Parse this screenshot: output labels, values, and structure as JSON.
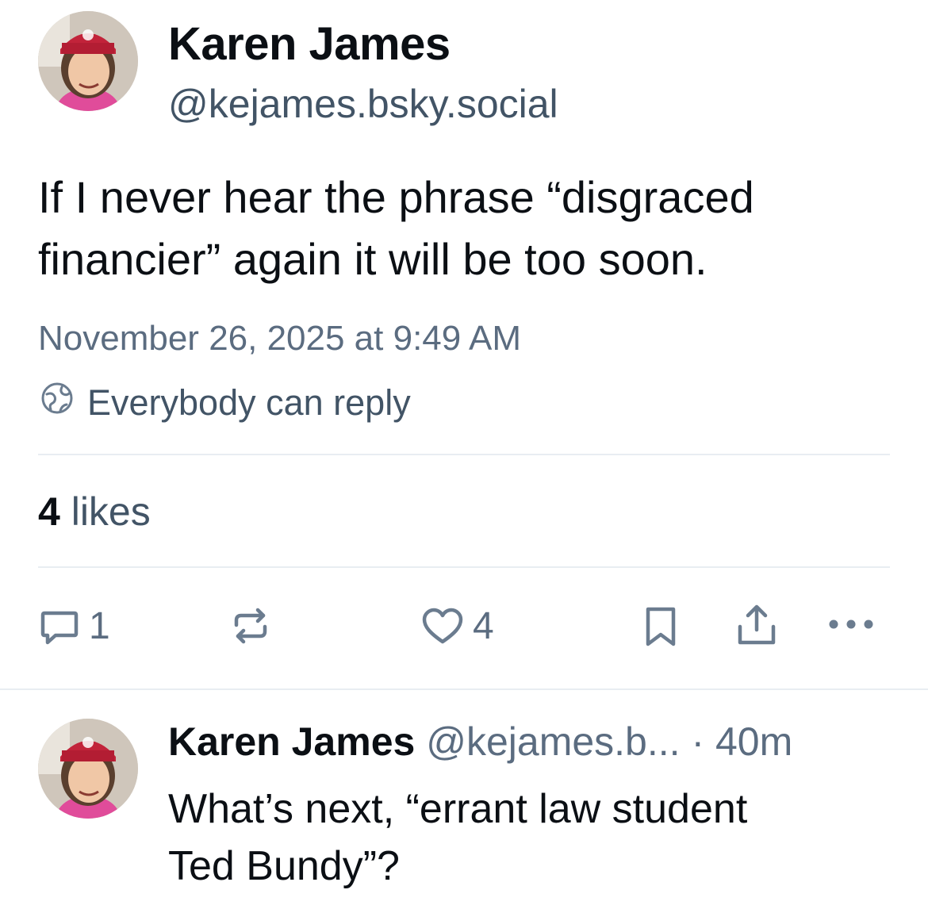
{
  "post": {
    "author_name": "Karen James",
    "author_handle": "@kejames.bsky.social",
    "text_line1": "If I never hear the phrase “disgraced",
    "text_line2": "financier” again it will be too soon.",
    "timestamp": "November 26, 2025 at 9:49 AM",
    "reply_setting": "Everybody can reply",
    "likes_count": "4",
    "likes_label": "likes"
  },
  "actions": {
    "reply_count": "1",
    "like_count": "4",
    "icons": [
      "reply-icon",
      "repost-icon",
      "like-icon",
      "bookmark-icon",
      "share-icon",
      "more-icon"
    ]
  },
  "reply": {
    "author_name": "Karen James",
    "author_handle": "@kejames.b...",
    "separator": "·",
    "age": "40m",
    "text_line1": "What’s next, “errant law student",
    "text_line2": "Ted Bundy”?"
  },
  "colors": {
    "text": "#0b0f14",
    "secondary": "#425466",
    "muted": "#5b6c80",
    "divider": "#e8edf2"
  }
}
